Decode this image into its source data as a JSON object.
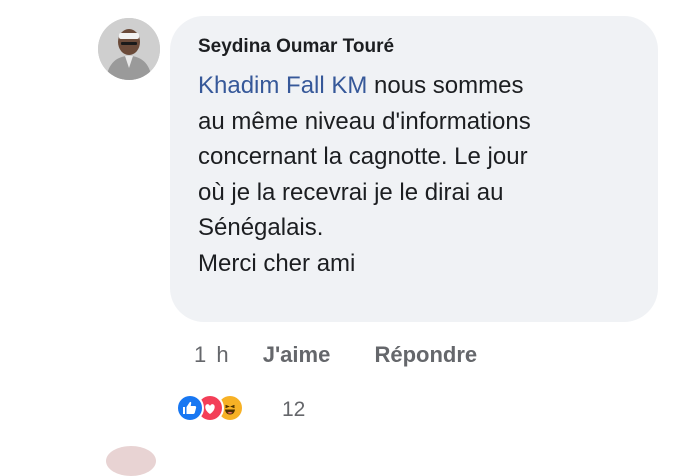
{
  "comment": {
    "author": "Seydina Oumar Touré",
    "mention": "Khadim Fall KM",
    "first_line_rest": " nous sommes",
    "lines": [
      "au même niveau d'informations",
      "concernant la cagnotte. Le jour",
      "où je la recevrai je le dirai au",
      "Sénégalais.",
      "Merci cher ami"
    ],
    "timestamp": "1 h",
    "like_label": "J'aime",
    "reply_label": "Répondre",
    "reaction_count": "12"
  },
  "reactions": [
    {
      "name": "like-icon",
      "color": "#1877f2"
    },
    {
      "name": "love-icon",
      "color": "#f33e58"
    },
    {
      "name": "haha-icon",
      "color": "#f7b125"
    }
  ],
  "colors": {
    "bubble": "#f0f2f5",
    "mention": "#365899",
    "meta": "#65676b",
    "text": "#1c1e21"
  }
}
